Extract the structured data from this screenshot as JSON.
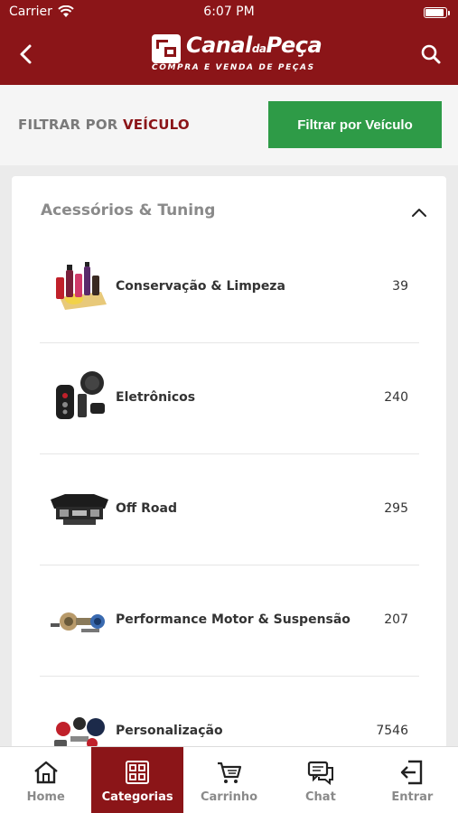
{
  "status_bar": {
    "carrier": "Carrier",
    "time": "6:07 PM"
  },
  "header": {
    "logo_name_a": "Canal",
    "logo_name_b": "da",
    "logo_name_c": "Peça",
    "logo_tagline": "COMPRA E VENDA DE PEÇAS",
    "back_icon": "chevron-left-icon",
    "search_icon": "search-icon"
  },
  "filter": {
    "label_prefix": "FILTRAR POR ",
    "label_accent": "VEÍCULO",
    "button_label": "Filtrar por Veículo",
    "button_color": "#2e9b47"
  },
  "category_group": {
    "title": "Acessórios & Tuning",
    "expanded": true,
    "items": [
      {
        "name": "Conservação & Limpeza",
        "count": "39",
        "icon": "cleaning-products-image"
      },
      {
        "name": "Eletrônicos",
        "count": "240",
        "icon": "car-alarm-electronics-image"
      },
      {
        "name": "Off Road",
        "count": "295",
        "icon": "offroad-bumper-image"
      },
      {
        "name": "Performance Motor & Suspensão",
        "count": "207",
        "icon": "turbo-parts-image"
      },
      {
        "name": "Personalização",
        "count": "7546",
        "icon": "custom-parts-image"
      }
    ]
  },
  "tabbar": {
    "active": "Categorias",
    "tabs": [
      {
        "label": "Home",
        "icon": "home-icon"
      },
      {
        "label": "Categorias",
        "icon": "grid-icon"
      },
      {
        "label": "Carrinho",
        "icon": "cart-icon"
      },
      {
        "label": "Chat",
        "icon": "chat-icon"
      },
      {
        "label": "Entrar",
        "icon": "login-icon"
      }
    ]
  },
  "colors": {
    "brand": "#8b1518",
    "accent_green": "#2e9b47",
    "text_gray": "#8a8a8a"
  }
}
